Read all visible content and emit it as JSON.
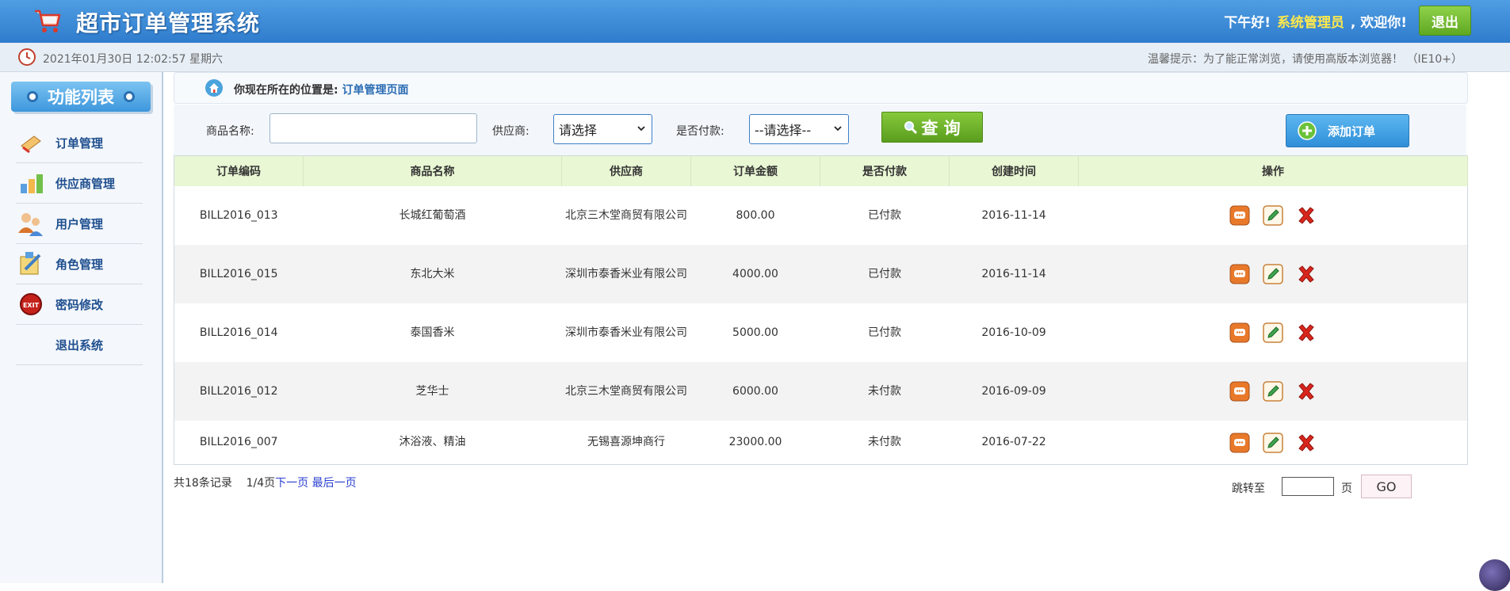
{
  "header": {
    "title": "超市订单管理系统",
    "greeting_prefix": "下午好!",
    "user_name": "系统管理员",
    "greeting_suffix": ", 欢迎你!",
    "logout_label": "退出",
    "datetime": "2021年01月30日 12:02:57 星期六",
    "tip": "温馨提示：为了能正常浏览，请使用高版本浏览器！ （IE10+）"
  },
  "sidebar": {
    "title": "功能列表",
    "items": [
      {
        "label": "订单管理",
        "icon": "order-icon"
      },
      {
        "label": "供应商管理",
        "icon": "supplier-icon"
      },
      {
        "label": "用户管理",
        "icon": "users-icon"
      },
      {
        "label": "角色管理",
        "icon": "role-icon"
      },
      {
        "label": "密码修改",
        "icon": "exit-icon"
      },
      {
        "label": "退出系统",
        "icon": ""
      }
    ]
  },
  "breadcrumb": {
    "prefix": "你现在所在的位置是:",
    "current": "订单管理页面"
  },
  "search": {
    "name_label": "商品名称:",
    "supplier_label": "供应商:",
    "supplier_value": "请选择",
    "paid_label": "是否付款:",
    "paid_value": "--请选择--",
    "query_label": "查 询",
    "add_label": "添加订单"
  },
  "table": {
    "headers": [
      "订单编码",
      "商品名称",
      "供应商",
      "订单金额",
      "是否付款",
      "创建时间",
      "操作"
    ],
    "rows": [
      {
        "code": "BILL2016_013",
        "product": "长城红葡萄酒",
        "supplier": "北京三木堂商贸有限公司",
        "amount": "800.00",
        "paid": "已付款",
        "created": "2016-11-14"
      },
      {
        "code": "BILL2016_015",
        "product": "东北大米",
        "supplier": "深圳市泰香米业有限公司",
        "amount": "4000.00",
        "paid": "已付款",
        "created": "2016-11-14"
      },
      {
        "code": "BILL2016_014",
        "product": "泰国香米",
        "supplier": "深圳市泰香米业有限公司",
        "amount": "5000.00",
        "paid": "已付款",
        "created": "2016-10-09"
      },
      {
        "code": "BILL2016_012",
        "product": "芝华士",
        "supplier": "北京三木堂商贸有限公司",
        "amount": "6000.00",
        "paid": "未付款",
        "created": "2016-09-09"
      },
      {
        "code": "BILL2016_007",
        "product": "沐浴液、精油",
        "supplier": "无锡喜源坤商行",
        "amount": "23000.00",
        "paid": "未付款",
        "created": "2016-07-22"
      }
    ]
  },
  "pager": {
    "total": "共18条记录",
    "page": "1/4页",
    "next": "下一页",
    "last": "最后一页",
    "jump_label": "跳转至",
    "unit": "页",
    "go": "GO"
  },
  "colors": {
    "header": "#3a86d6",
    "table_header": "#e9f7d4",
    "accent_green": "#6ab22c",
    "link": "#2a6bb3"
  }
}
